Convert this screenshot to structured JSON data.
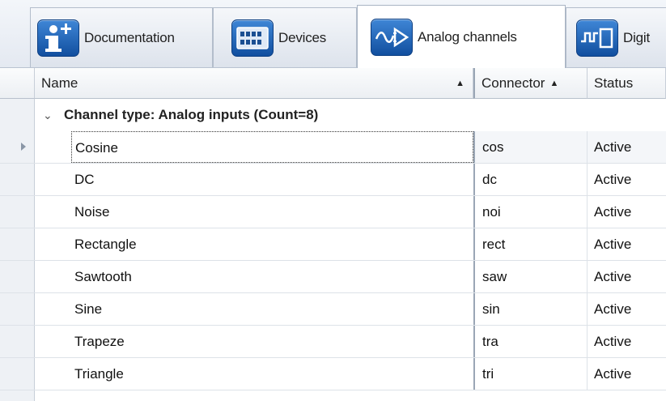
{
  "tabs": [
    {
      "label": "Documentation",
      "icon": "info-icon",
      "active": false
    },
    {
      "label": "Devices",
      "icon": "devices-icon",
      "active": false
    },
    {
      "label": "Analog channels",
      "icon": "analog-channels-icon",
      "active": true
    },
    {
      "label": "Digit",
      "icon": "digital-channels-icon",
      "active": false
    }
  ],
  "grid": {
    "columns": [
      {
        "label": "Name",
        "sort": "▲"
      },
      {
        "label": "Connector",
        "sort": "▲"
      },
      {
        "label": "Status"
      }
    ],
    "group": {
      "label": "Channel type: Analog inputs (Count=8)",
      "chevron": "⌄"
    },
    "rows": [
      {
        "name": "Cosine",
        "connector": "cos",
        "status": "Active"
      },
      {
        "name": "DC",
        "connector": "dc",
        "status": "Active"
      },
      {
        "name": "Noise",
        "connector": "noi",
        "status": "Active"
      },
      {
        "name": "Rectangle",
        "connector": "rect",
        "status": "Active"
      },
      {
        "name": "Sawtooth",
        "connector": "saw",
        "status": "Active"
      },
      {
        "name": "Sine",
        "connector": "sin",
        "status": "Active"
      },
      {
        "name": "Trapeze",
        "connector": "tra",
        "status": "Active"
      },
      {
        "name": "Triangle",
        "connector": "tri",
        "status": "Active"
      }
    ]
  },
  "colors": {
    "accent": "#1e63b8",
    "grid_line": "#dde2e8"
  }
}
